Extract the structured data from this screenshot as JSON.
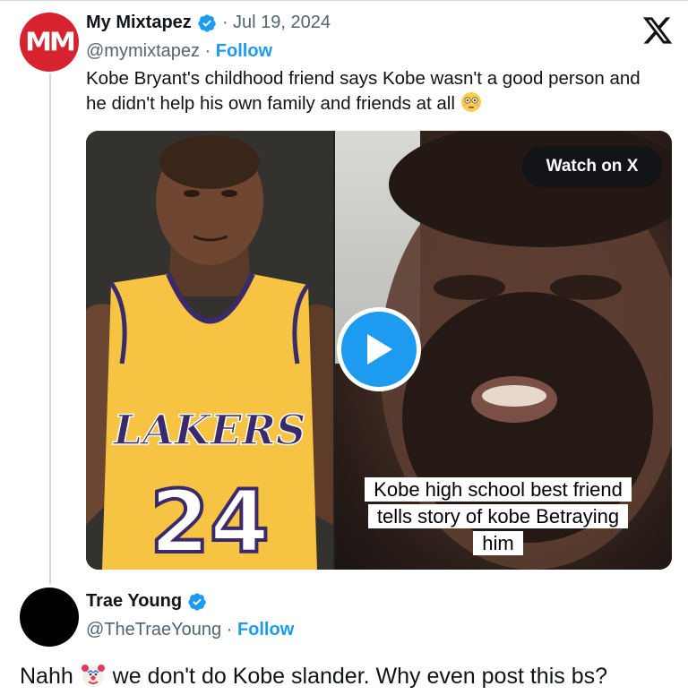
{
  "post": {
    "author_name": "My Mixtapez",
    "avatar_text": "MM",
    "date": "· Jul 19, 2024",
    "handle": "@mymixtapez",
    "separator": " · ",
    "follow_label": "Follow",
    "text": "Kobe Bryant's childhood friend says Kobe wasn't a good person and he didn't help his own family and friends at all",
    "text_emoji": "flushed-face-emoji"
  },
  "media": {
    "watch_label": "Watch on X",
    "left_image": "kobe-bryant-lakers-photo",
    "right_image": "man-talking-video-frame",
    "jersey_team": "LAKERS",
    "jersey_number": "24",
    "caption_lines": [
      "Kobe high school best friend",
      "tells story of kobe Betraying",
      "him"
    ]
  },
  "reply": {
    "author_name": "Trae Young",
    "handle": "@TheTraeYoung",
    "separator": " · ",
    "follow_label": "Follow",
    "text_before": "Nahh",
    "text_emoji": "clown-face-emoji",
    "text_after": " we don't do Kobe slander. Why even post this bs?"
  },
  "colors": {
    "brand_red": "#d6232f",
    "link_blue": "#1d9bf0",
    "muted": "#536471",
    "jersey_yellow": "#f6c343",
    "jersey_purple": "#3b2a6b"
  }
}
